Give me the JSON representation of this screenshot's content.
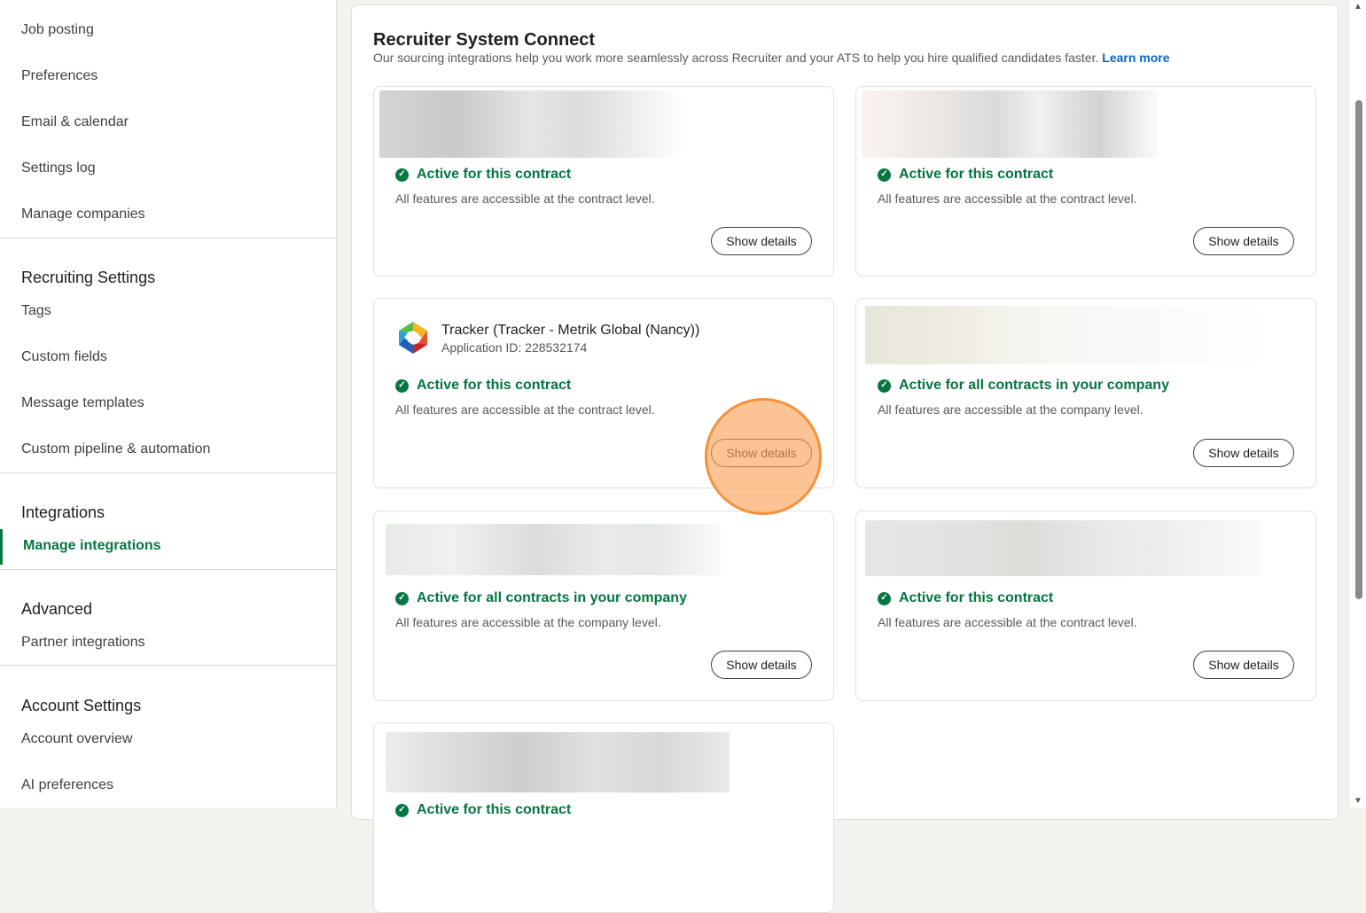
{
  "sidebar": {
    "top_items": [
      "Job posting",
      "Preferences",
      "Email & calendar",
      "Settings log",
      "Manage companies"
    ],
    "recruiting": {
      "heading": "Recruiting Settings",
      "items": [
        "Tags",
        "Custom fields",
        "Message templates",
        "Custom pipeline & automation"
      ]
    },
    "integrations": {
      "heading": "Integrations",
      "active_item": "Manage integrations"
    },
    "advanced": {
      "heading": "Advanced",
      "items": [
        "Partner integrations"
      ]
    },
    "account": {
      "heading": "Account Settings",
      "items": [
        "Account overview",
        "AI preferences"
      ]
    }
  },
  "main": {
    "title": "Recruiter System Connect",
    "description": "Our sourcing integrations help you work more seamlessly across Recruiter and your ATS to help you hire qualified candidates faster.",
    "learn_more": "Learn more"
  },
  "cards": [
    {
      "status": "Active for this contract",
      "note": "All features are accessible at the contract level.",
      "button": "Show details"
    },
    {
      "status": "Active for this contract",
      "note": "All features are accessible at the contract level.",
      "button": "Show details"
    },
    {
      "app_name": "Tracker (Tracker - Metrik Global (Nancy))",
      "app_id": "Application ID: 228532174",
      "status": "Active for this contract",
      "note": "All features are accessible at the contract level.",
      "button": "Show details"
    },
    {
      "status": "Active for all contracts in your company",
      "note": "All features are accessible at the company level.",
      "button": "Show details"
    },
    {
      "status": "Active for all contracts in your company",
      "note": "All features are accessible at the company level.",
      "button": "Show details"
    },
    {
      "status": "Active for this contract",
      "note": "All features are accessible at the contract level.",
      "button": "Show details"
    },
    {
      "status": "Active for this contract"
    }
  ],
  "icons": {
    "status": "check-circle-icon",
    "app": "tracker-logo-icon"
  },
  "colors": {
    "accent_green": "#057642",
    "link_blue": "#0a66c2",
    "highlight_orange": "#f5913c"
  }
}
